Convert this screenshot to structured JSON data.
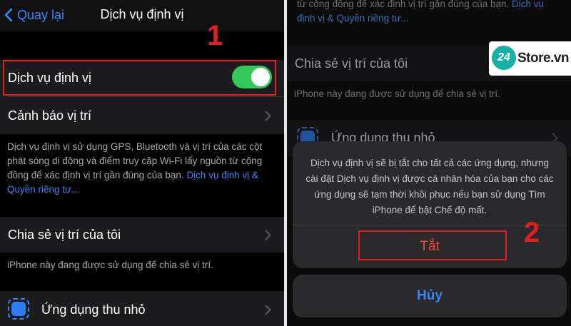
{
  "left": {
    "back_label": "Quay lại",
    "title": "Dịch vụ định vị",
    "location_services_label": "Dịch vụ định vị",
    "location_services_on": true,
    "location_alerts_label": "Cảnh báo vị trí",
    "footer_text": "Dịch vụ định vị sử dụng GPS, Bluetooth và vị trí của các cột phát sóng di động và điểm truy cập Wi-Fi lấy nguồn từ cộng đồng để xác định vị trí gần đúng của bạn. ",
    "footer_link": "Dịch vụ định vị & Quyền riêng tư...",
    "share_location_label": "Chia sẻ vị trí của tôi",
    "share_footer": "iPhone này đang được sử dụng để chia sẻ vị trí.",
    "app_item_label": "Ứng dụng thu nhỏ",
    "step_marker": "1"
  },
  "right": {
    "top_text": "từ cộng đồng để xác định vị trí gần đúng của bạn. ",
    "top_link": "Dịch vụ định vị & Quyền riêng tư...",
    "share_location_label": "Chia sẻ vị trí của tôi",
    "share_footer": "iPhone này đang được sử dụng để chia sẻ vị trí.",
    "app_item_label": "Ứng dụng thu nhỏ",
    "dialog_message": "Dịch vụ định vị sẽ bị tắt cho tất cả các ứng dụng, nhưng cài đặt Dịch vụ định vị được cá nhân hóa của bạn cho các ứng dụng sẽ tạm thời khôi phục nếu bạn sử dụng Tìm iPhone để bật Chế độ mất.",
    "turn_off_label": "Tắt",
    "cancel_label": "Hủy",
    "step_marker": "2",
    "logo_badge": "24",
    "logo_text": "Store.vn"
  },
  "colors": {
    "accent_blue": "#3a86f7",
    "toggle_green": "#34c759",
    "destructive_red": "#ff453a",
    "highlight_red": "#e02020"
  }
}
